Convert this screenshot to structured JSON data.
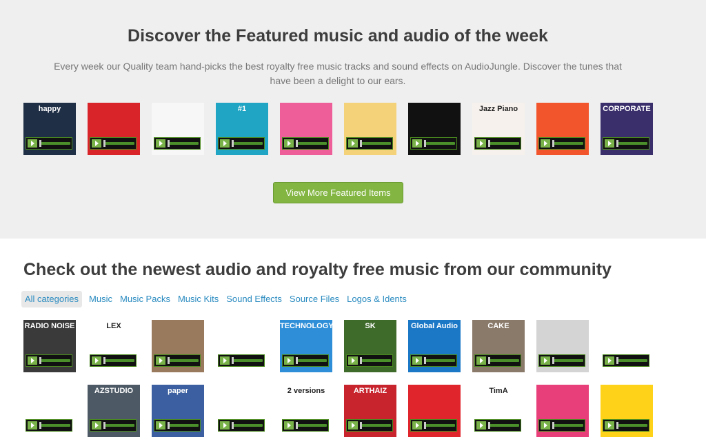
{
  "featured": {
    "title": "Discover the Featured music and audio of the week",
    "desc_line1": "Every week our Quality team hand-picks the best royalty free music tracks and sound effects on AudioJungle. Discover the tunes that",
    "desc_line2": "have been a delight to our ears.",
    "more_button": "View More Featured Items",
    "items": [
      {
        "caption": "happy",
        "color": "#1f2f46"
      },
      {
        "caption": "",
        "color": "#d9252a"
      },
      {
        "caption": "",
        "color": "#f7f7f7"
      },
      {
        "caption": "#1",
        "color": "#21a5c4"
      },
      {
        "caption": "",
        "color": "#ee5f9a"
      },
      {
        "caption": "",
        "color": "#f4d27a"
      },
      {
        "caption": "",
        "color": "#111111"
      },
      {
        "caption": "Jazz Piano",
        "color": "#f6f1ec"
      },
      {
        "caption": "",
        "color": "#f2552b"
      },
      {
        "caption": "CORPORATE",
        "color": "#3a2f6b"
      }
    ]
  },
  "newest": {
    "title": "Check out the newest audio and royalty free music from our community",
    "categories": [
      "All categories",
      "Music",
      "Music Packs",
      "Music Kits",
      "Sound Effects",
      "Source Files",
      "Logos & Idents"
    ],
    "row1": [
      {
        "caption": "RADIO NOISE",
        "color": "#3a3a3a"
      },
      {
        "caption": "LEX",
        "color": "#ffffff"
      },
      {
        "caption": "",
        "color": "#9a7a5c"
      },
      {
        "caption": "",
        "color": "#ffffff"
      },
      {
        "caption": "TECHNOLOGY",
        "color": "#2e8fd8"
      },
      {
        "caption": "SK",
        "color": "#3e6a2a"
      },
      {
        "caption": "Global Audio",
        "color": "#1b78c7"
      },
      {
        "caption": "CAKE",
        "color": "#8a7a6a"
      },
      {
        "caption": "",
        "color": "#d4d4d4"
      },
      {
        "caption": "",
        "color": "#ffffff"
      }
    ],
    "row2": [
      {
        "caption": "",
        "color": "#ffffff"
      },
      {
        "caption": "AZSTUDIO",
        "color": "#4d5a66"
      },
      {
        "caption": "paper",
        "color": "#3b5fa0"
      },
      {
        "caption": "",
        "color": "#ffffff"
      },
      {
        "caption": "2 versions",
        "color": "#ffffff"
      },
      {
        "caption": "ARTHAIZ",
        "color": "#c8242e"
      },
      {
        "caption": "",
        "color": "#e0252c"
      },
      {
        "caption": "TimA",
        "color": "#ffffff"
      },
      {
        "caption": "",
        "color": "#e83e7a"
      },
      {
        "caption": "",
        "color": "#ffd21a"
      }
    ]
  }
}
